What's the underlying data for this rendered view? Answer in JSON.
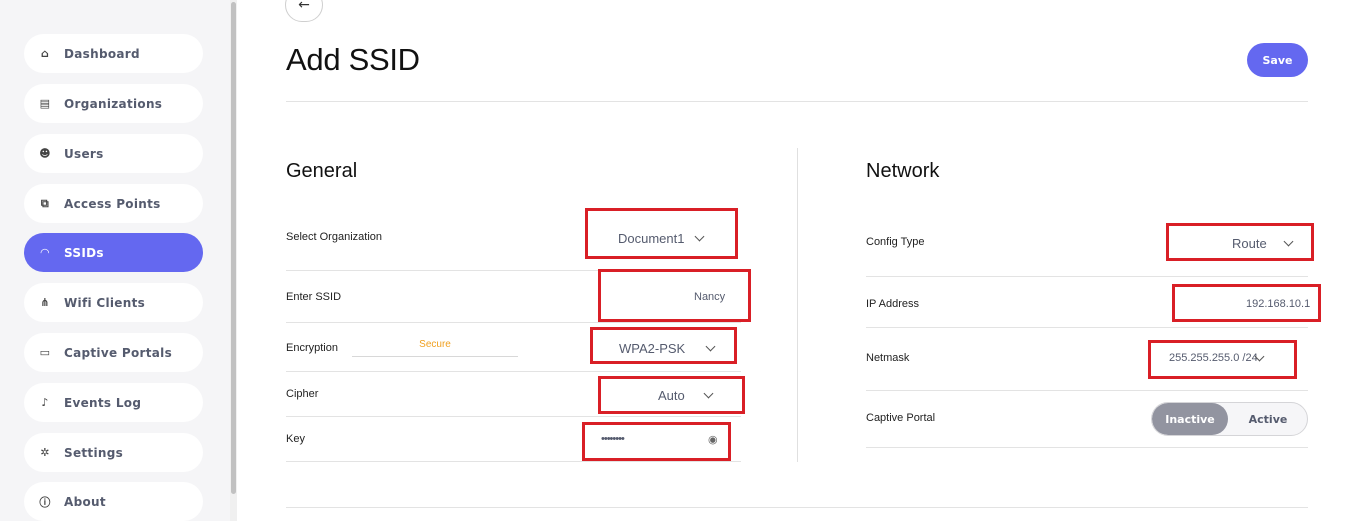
{
  "sidebar": {
    "items": [
      {
        "label": "Dashboard",
        "icon": "home-icon",
        "glyph": "⌂"
      },
      {
        "label": "Organizations",
        "icon": "building-icon",
        "glyph": "▤"
      },
      {
        "label": "Users",
        "icon": "users-icon",
        "glyph": "☻"
      },
      {
        "label": "Access Points",
        "icon": "devices-icon",
        "glyph": "⧉"
      },
      {
        "label": "SSIDs",
        "icon": "wifi-icon",
        "glyph": "◠"
      },
      {
        "label": "Wifi Clients",
        "icon": "network-icon",
        "glyph": "⋔"
      },
      {
        "label": "Captive Portals",
        "icon": "monitor-icon",
        "glyph": "▭"
      },
      {
        "label": "Events Log",
        "icon": "bell-icon",
        "glyph": "♪"
      },
      {
        "label": "Settings",
        "icon": "gear-icon",
        "glyph": "✲"
      },
      {
        "label": "About",
        "icon": "info-icon",
        "glyph": "ⓘ"
      }
    ],
    "active_index": 4
  },
  "header": {
    "back_glyph": "←",
    "title": "Add SSID",
    "save_label": "Save"
  },
  "general": {
    "title": "General",
    "organization": {
      "label": "Select Organization",
      "value": "Document1"
    },
    "ssid": {
      "label": "Enter SSID",
      "value": "Nancy"
    },
    "encryption": {
      "label": "Encryption",
      "strength": "Secure",
      "value": "WPA2-PSK"
    },
    "cipher": {
      "label": "Cipher",
      "value": "Auto"
    },
    "key": {
      "label": "Key",
      "value": "••••••••",
      "eye_glyph": "◉"
    }
  },
  "network": {
    "title": "Network",
    "config_type": {
      "label": "Config Type",
      "value": "Route"
    },
    "ip_address": {
      "label": "IP Address",
      "value": "192.168.10.1"
    },
    "netmask": {
      "label": "Netmask",
      "value": "255.255.255.0 /24"
    },
    "captive_portal": {
      "label": "Captive Portal",
      "inactive": "Inactive",
      "active": "Active"
    }
  },
  "colors": {
    "accent": "#6468f0",
    "highlight_box": "#d91f26",
    "secure": "#f0a020"
  }
}
